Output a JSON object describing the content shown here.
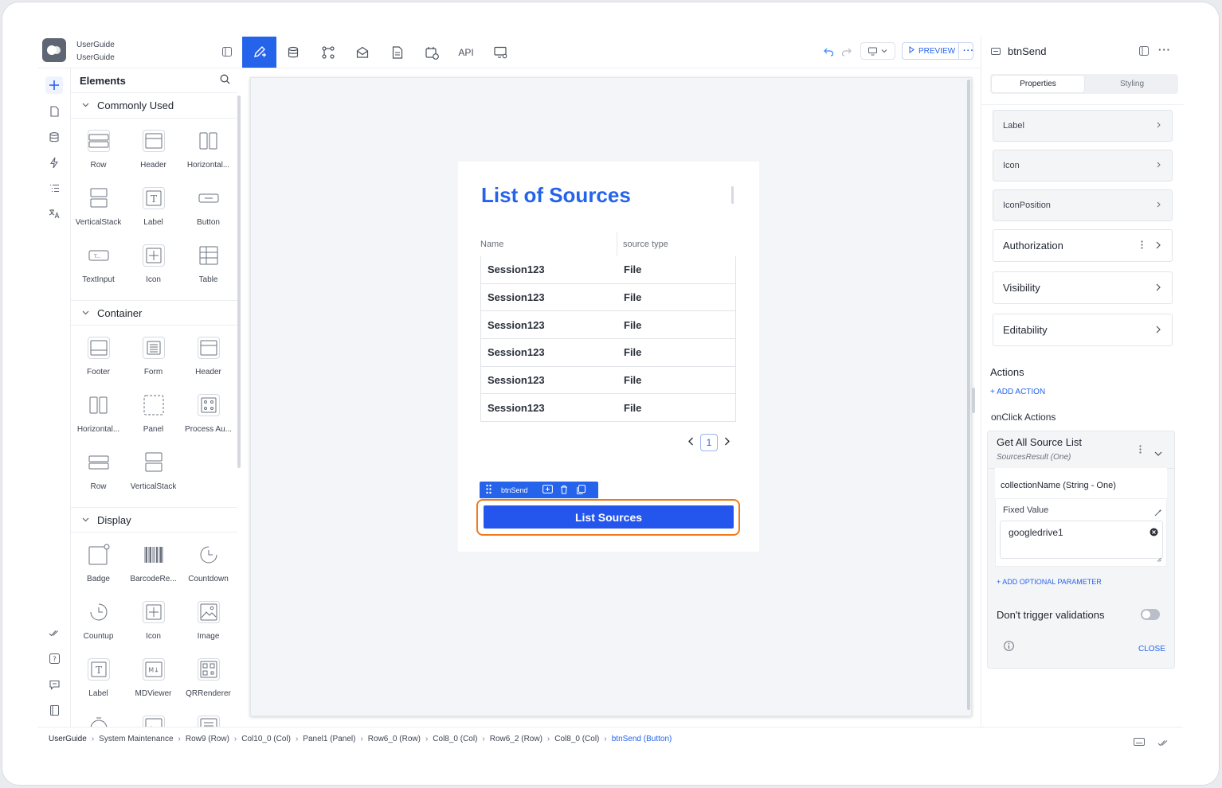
{
  "app": {
    "name_line1": "UserGuide",
    "name_line2": "UserGuide"
  },
  "elements_panel": {
    "title": "Elements",
    "sections": [
      {
        "title": "Commonly Used",
        "items": [
          "Row",
          "Header",
          "Horizontal...",
          "VerticalStack",
          "Label",
          "Button",
          "TextInput",
          "Icon",
          "Table"
        ]
      },
      {
        "title": "Container",
        "items": [
          "Footer",
          "Form",
          "Header",
          "Horizontal...",
          "Panel",
          "Process Au...",
          "Row",
          "VerticalStack"
        ]
      },
      {
        "title": "Display",
        "items": [
          "Badge",
          "BarcodeRe...",
          "Countdown",
          "Countup",
          "Icon",
          "Image",
          "Label",
          "MDViewer",
          "QRRenderer"
        ]
      }
    ]
  },
  "toolbar": {
    "api_label": "API",
    "preview_label": "PREVIEW"
  },
  "canvas": {
    "title": "List of Sources",
    "table": {
      "columns": [
        "Name",
        "source type"
      ],
      "rows": [
        [
          "Session123",
          "File"
        ],
        [
          "Session123",
          "File"
        ],
        [
          "Session123",
          "File"
        ],
        [
          "Session123",
          "File"
        ],
        [
          "Session123",
          "File"
        ],
        [
          "Session123",
          "File"
        ]
      ]
    },
    "page": "1",
    "selected_name": "btnSend",
    "button_label": "List Sources"
  },
  "properties": {
    "component": "btnSend",
    "tabs": [
      "Properties",
      "Styling"
    ],
    "small_rows": [
      "Label",
      "Icon",
      "IconPosition"
    ],
    "large_rows": [
      "Authorization",
      "Visibility",
      "Editability"
    ],
    "actions_title": "Actions",
    "add_action": "+ ADD ACTION",
    "onclick_title": "onClick Actions",
    "action": {
      "name": "Get All Source List",
      "result": "SourcesResult (One)",
      "param_name": "collectionName (String - One)",
      "param_mode": "Fixed Value",
      "param_value": "googledrive1",
      "add_optional": "+ ADD OPTIONAL PARAMETER",
      "no_validations": "Don't trigger validations",
      "close": "CLOSE"
    }
  },
  "breadcrumb": [
    "UserGuide",
    "System Maintenance",
    "Row9 (Row)",
    "Col10_0 (Col)",
    "Panel1 (Panel)",
    "Row6_0 (Row)",
    "Col8_0 (Col)",
    "Row6_2 (Row)",
    "Col8_0 (Col)",
    "btnSend (Button)"
  ],
  "colors": {
    "accent": "#2563eb",
    "highlight": "#f07a1a"
  }
}
